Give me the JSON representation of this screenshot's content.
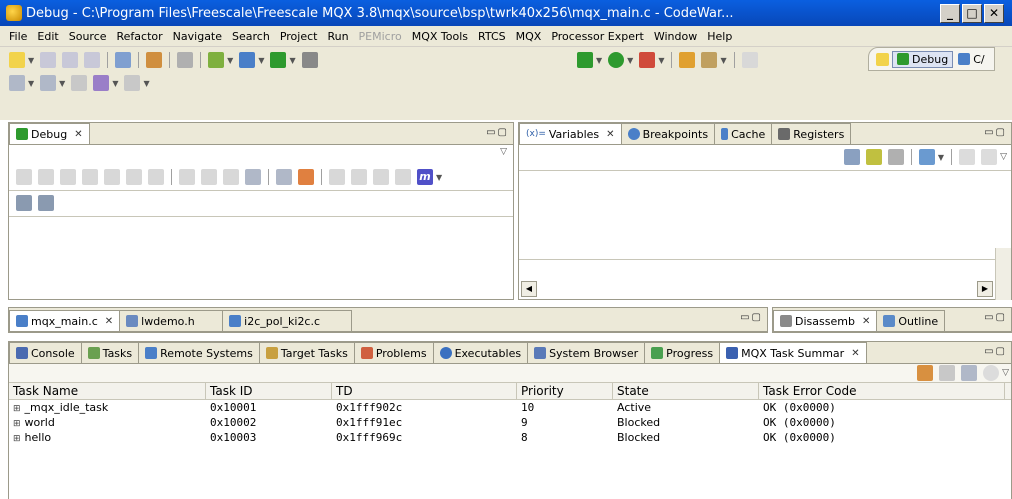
{
  "window": {
    "title": "Debug - C:\\Program Files\\Freescale\\Freescale MQX 3.8\\mqx\\source\\bsp\\twrk40x256\\mqx_main.c - CodeWar...",
    "min": "_",
    "max": "□",
    "close": "✕"
  },
  "menu": [
    "File",
    "Edit",
    "Source",
    "Refactor",
    "Navigate",
    "Search",
    "Project",
    "Run",
    "PEMicro",
    "MQX Tools",
    "RTCS",
    "MQX",
    "Processor Expert",
    "Window",
    "Help"
  ],
  "perspectives": {
    "debug": "Debug",
    "cc": "C/"
  },
  "debug_panel": {
    "tab": "Debug"
  },
  "variables_panel": {
    "tabs": [
      "Variables",
      "Breakpoints",
      "Cache",
      "Registers"
    ],
    "prefix": "(x)="
  },
  "editor": {
    "tabs": [
      "mqx_main.c",
      "lwdemo.h",
      "i2c_pol_ki2c.c"
    ]
  },
  "side_panel": {
    "tabs": [
      "Disassemb",
      "Outline"
    ]
  },
  "bottom_panel": {
    "tabs": [
      "Console",
      "Tasks",
      "Remote Systems",
      "Target Tasks",
      "Problems",
      "Executables",
      "System Browser",
      "Progress",
      "MQX Task Summar"
    ],
    "columns": [
      "Task Name",
      "Task ID",
      "TD",
      "Priority",
      "State",
      "Task Error Code"
    ],
    "rows": [
      {
        "name": "_mqx_idle_task",
        "id": "0x10001",
        "td": "0x1fff902c",
        "priority": "10",
        "state": "Active",
        "error": "OK (0x0000)"
      },
      {
        "name": "world",
        "id": "0x10002",
        "td": "0x1fff91ec",
        "priority": "9",
        "state": "Blocked",
        "error": "OK (0x0000)"
      },
      {
        "name": "hello",
        "id": "0x10003",
        "td": "0x1fff969c",
        "priority": "8",
        "state": "Blocked",
        "error": "OK (0x0000)"
      }
    ]
  },
  "colors": {
    "title_bar": "#0a5fe0",
    "chrome": "#ece9d8",
    "border": "#9c9a8a",
    "debug_green": "#2e9a2e"
  }
}
